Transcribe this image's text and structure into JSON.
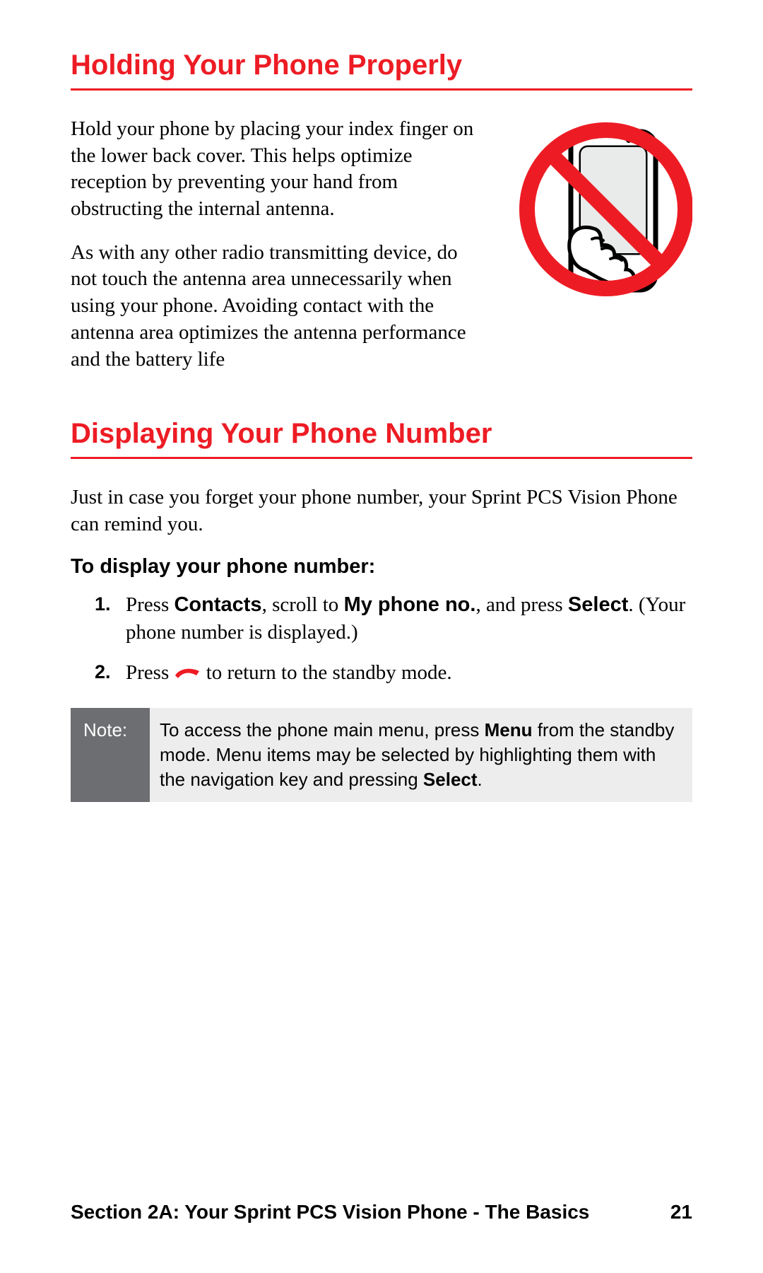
{
  "section1": {
    "heading": "Holding Your Phone Properly",
    "para1": "Hold your phone by placing your index finger on the lower back cover. This helps optimize reception by preventing your hand from obstructing the internal antenna.",
    "para2": "As with any other radio transmitting device, do not touch the antenna area unnecessarily when using your phone. Avoiding contact with the antenna area optimizes the antenna performance and the battery life"
  },
  "section2": {
    "heading": "Displaying Your Phone Number",
    "intro": "Just in case you forget your phone number, your Sprint PCS Vision Phone can remind you.",
    "subhead": "To display your phone number:",
    "step1": {
      "t1": "Press ",
      "b1": "Contacts",
      "t2": ", scroll to ",
      "b2": "My phone no.",
      "t3": ", and press ",
      "b3": "Select",
      "t4": ". (Your phone number is displayed.)"
    },
    "step2": {
      "t1": "Press ",
      "t2": " to return to the standby mode."
    },
    "note": {
      "label": "Note:",
      "t1": "To access the phone main menu, press ",
      "b1": "Menu",
      "t2": " from the standby mode. Menu items may be selected by highlighting them with the navigation key and pressing ",
      "b2": "Select",
      "t3": "."
    }
  },
  "footer": {
    "left": "Section 2A: Your Sprint PCS Vision Phone - The Basics",
    "right": "21"
  },
  "colors": {
    "accent": "#ed1c24"
  }
}
